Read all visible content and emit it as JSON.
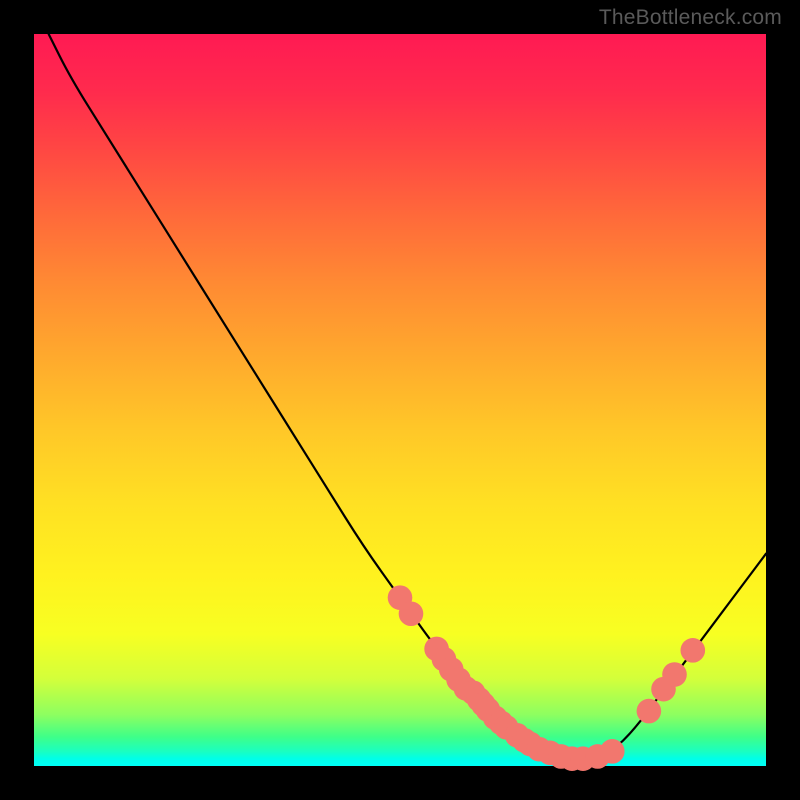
{
  "watermark": "TheBottleneck.com",
  "chart_data": {
    "type": "line",
    "title": "",
    "xlabel": "",
    "ylabel": "",
    "xlim": [
      0,
      100
    ],
    "ylim": [
      0,
      100
    ],
    "grid": false,
    "line": {
      "name": "curve",
      "color": "#000000",
      "points": [
        {
          "x": 2,
          "y": 100
        },
        {
          "x": 5,
          "y": 94
        },
        {
          "x": 10,
          "y": 86
        },
        {
          "x": 15,
          "y": 78
        },
        {
          "x": 20,
          "y": 70
        },
        {
          "x": 25,
          "y": 62
        },
        {
          "x": 30,
          "y": 54
        },
        {
          "x": 35,
          "y": 46
        },
        {
          "x": 40,
          "y": 38
        },
        {
          "x": 45,
          "y": 30
        },
        {
          "x": 50,
          "y": 23
        },
        {
          "x": 55,
          "y": 16
        },
        {
          "x": 60,
          "y": 10
        },
        {
          "x": 65,
          "y": 5
        },
        {
          "x": 70,
          "y": 2
        },
        {
          "x": 73,
          "y": 1
        },
        {
          "x": 76,
          "y": 1
        },
        {
          "x": 79,
          "y": 2
        },
        {
          "x": 82,
          "y": 5
        },
        {
          "x": 85,
          "y": 9
        },
        {
          "x": 88,
          "y": 13
        },
        {
          "x": 91,
          "y": 17
        },
        {
          "x": 94,
          "y": 21
        },
        {
          "x": 97,
          "y": 25
        },
        {
          "x": 100,
          "y": 29
        }
      ]
    },
    "scatter": {
      "name": "markers",
      "color": "#f2776e",
      "rx": 1.2,
      "ry": 1.2,
      "points": [
        {
          "x": 50,
          "y": 23
        },
        {
          "x": 51.5,
          "y": 20.8
        },
        {
          "x": 55,
          "y": 16
        },
        {
          "x": 56,
          "y": 14.6
        },
        {
          "x": 57,
          "y": 13.2
        },
        {
          "x": 58,
          "y": 11.8
        },
        {
          "x": 59,
          "y": 10.6
        },
        {
          "x": 60,
          "y": 10
        },
        {
          "x": 60.8,
          "y": 9.1
        },
        {
          "x": 61.4,
          "y": 8.4
        },
        {
          "x": 62,
          "y": 7.7
        },
        {
          "x": 63,
          "y": 6.6
        },
        {
          "x": 63.8,
          "y": 5.9
        },
        {
          "x": 64.5,
          "y": 5.3
        },
        {
          "x": 66,
          "y": 4.2
        },
        {
          "x": 67,
          "y": 3.5
        },
        {
          "x": 67.8,
          "y": 3.0
        },
        {
          "x": 69,
          "y": 2.3
        },
        {
          "x": 70.5,
          "y": 1.8
        },
        {
          "x": 72,
          "y": 1.3
        },
        {
          "x": 73.5,
          "y": 1.0
        },
        {
          "x": 75,
          "y": 1.0
        },
        {
          "x": 77,
          "y": 1.3
        },
        {
          "x": 79,
          "y": 2.0
        },
        {
          "x": 84,
          "y": 7.5
        },
        {
          "x": 86,
          "y": 10.5
        },
        {
          "x": 87.5,
          "y": 12.5
        },
        {
          "x": 90,
          "y": 15.8
        }
      ]
    },
    "colors": {
      "background_top": "#ff1a53",
      "background_bottom": "#00fff7",
      "frame": "#000000"
    }
  }
}
